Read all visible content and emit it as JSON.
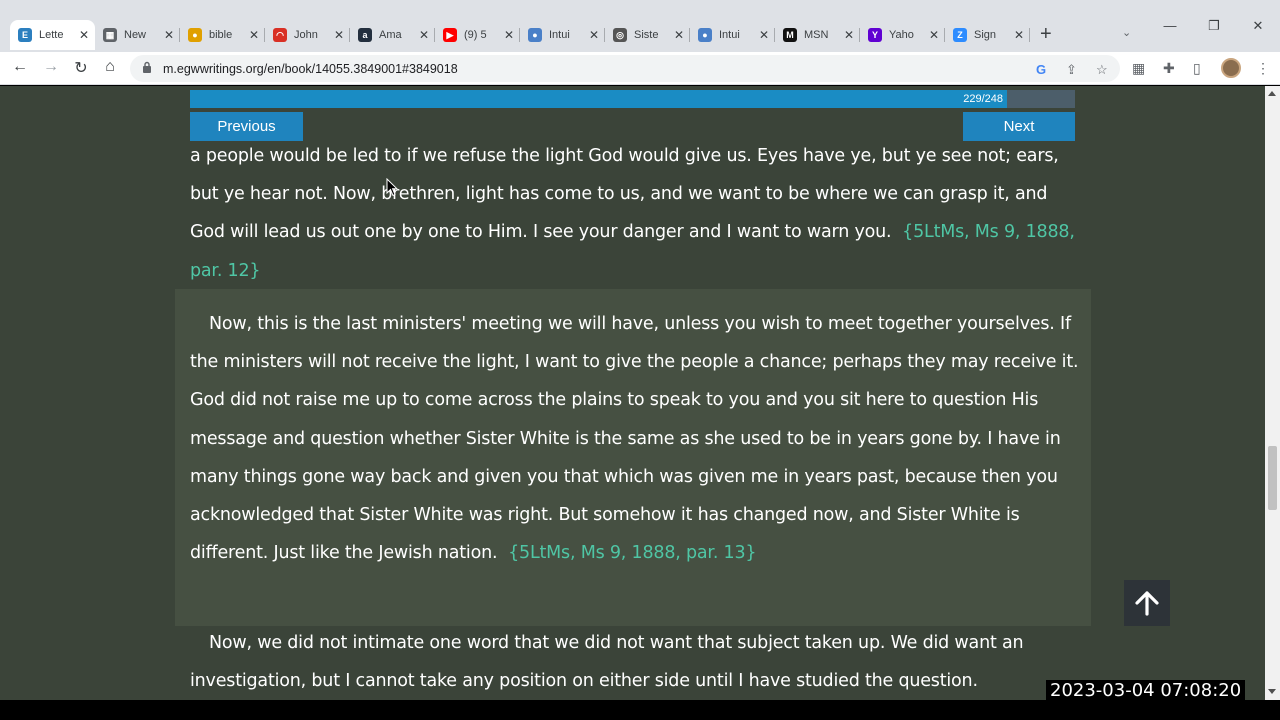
{
  "browser": {
    "tabs": [
      {
        "label": "Lette",
        "icon": "egw-icon",
        "color": "#2c7fbf",
        "glyph": "E",
        "active": true
      },
      {
        "label": "New",
        "icon": "sheet-icon",
        "color": "#5f6368",
        "glyph": "▦",
        "active": false
      },
      {
        "label": "bible",
        "icon": "chrome-icon",
        "color": "#e0a000",
        "glyph": "●",
        "active": false
      },
      {
        "label": "John",
        "icon": "loader-icon",
        "color": "#d93025",
        "glyph": "◠",
        "active": false
      },
      {
        "label": "Ama",
        "icon": "amazon-icon",
        "color": "#232f3e",
        "glyph": "a",
        "active": false
      },
      {
        "label": "(9) 5",
        "icon": "youtube-icon",
        "color": "#ff0000",
        "glyph": "▶",
        "active": false
      },
      {
        "label": "Intui",
        "icon": "globe-icon",
        "color": "#4a80c8",
        "glyph": "●",
        "active": false
      },
      {
        "label": "Siste",
        "icon": "compass-icon",
        "color": "#555",
        "glyph": "◎",
        "active": false
      },
      {
        "label": "Intui",
        "icon": "globe-icon",
        "color": "#4a80c8",
        "glyph": "●",
        "active": false
      },
      {
        "label": "MSN",
        "icon": "msn-icon",
        "color": "#111",
        "glyph": "M",
        "active": false
      },
      {
        "label": "Yaho",
        "icon": "yahoo-icon",
        "color": "#6001d2",
        "glyph": "Y",
        "active": false
      },
      {
        "label": "Sign",
        "icon": "zoom-icon",
        "color": "#2d8cff",
        "glyph": "Z",
        "active": false
      }
    ],
    "close_glyph": "✕",
    "new_tab_glyph": "+",
    "url": "m.egwwritings.org/en/book/14055.3849001#3849018"
  },
  "reader": {
    "progress_text": "229/248",
    "progress_value": 0.923,
    "prev_label": "Previous",
    "next_label": "Next",
    "paragraphs": [
      {
        "text": "a people would be led to if we refuse the light God would give us. Eyes have ye, but ye see not; ears, but ye hear not. Now, brethren, light has come to us, and we want to be where we can grasp it, and God will lead us out one by one to Him. I see your danger and I want to warn you.",
        "ref": "{5LtMs, Ms 9, 1888, par. 12}"
      },
      {
        "text": "Now, this is the last ministers' meeting we will have, unless you wish to meet together yourselves. If the ministers will not receive the light, I want to give the people a chance; perhaps they may receive it. God did not raise me up to come across the plains to speak to you and you sit here to question His message and question whether Sister White is the same as she used to be in years gone by. I have in many things gone way back and given you that which was given me in years past, because then you acknowledged that Sister White was right. But somehow it has changed now, and Sister White is different. Just like the Jewish nation.",
        "ref": "{5LtMs, Ms 9, 1888, par. 13}"
      },
      {
        "text": "Now, we did not intimate one word that we did not want that subject taken up. We did want an investigation, but I cannot take any position on either side until I have studied the question.",
        "ref": ""
      }
    ]
  },
  "overlay": {
    "timestamp": "2023-03-04  07:08:20"
  }
}
